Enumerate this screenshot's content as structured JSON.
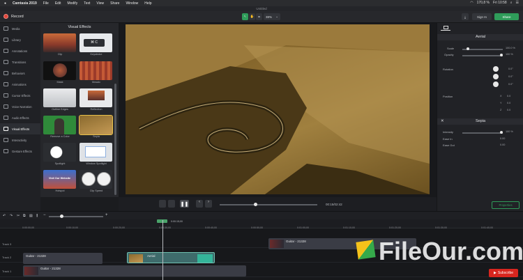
{
  "menubar": {
    "apple": "",
    "items": [
      "Camtasia 2019",
      "File",
      "Edit",
      "Modify",
      "Text",
      "View",
      "Share",
      "Window",
      "Help"
    ],
    "status": {
      "battery": "170,8 %",
      "clock": "Fri 10:58"
    }
  },
  "window": {
    "title": "Untitled"
  },
  "toolbar": {
    "record_label": "Record",
    "zoom": "38%",
    "signin_label": "Sign In",
    "share_label": "Share"
  },
  "rail": {
    "items": [
      "Media",
      "Library",
      "Annotations",
      "Transitions",
      "Behaviors",
      "Animations",
      "Cursor Effects",
      "Voice Narration",
      "Audio Effects",
      "Visual Effects",
      "Interactivity",
      "Gesture Effects"
    ]
  },
  "fx": {
    "title": "Visual Effects",
    "items": [
      {
        "label": "Clip"
      },
      {
        "label": "Keystroke"
      },
      {
        "label": "Mask"
      },
      {
        "label": "Mosaic"
      },
      {
        "label": "Outline Edges"
      },
      {
        "label": "Reflection"
      },
      {
        "label": "Remove a Color"
      },
      {
        "label": "Sepia"
      },
      {
        "label": "Spotlight"
      },
      {
        "label": "Window Spotlight"
      },
      {
        "label": "Hotspot"
      },
      {
        "label": "Clip Speed"
      }
    ],
    "keystroke_text": "⌘ C",
    "hotspot_text": "Visit Our Website"
  },
  "props": {
    "section1": "Aerial",
    "scale_label": "Scale",
    "scale_value": "100.0 %",
    "opacity_label": "Opacity",
    "opacity_value": "100 %",
    "rotation_label": "Rotation",
    "rotation_values": [
      "0.0°",
      "0.0°",
      "0.0°"
    ],
    "position_label": "Position",
    "position_values": [
      "0.0",
      "0.0",
      "0.0"
    ],
    "position_axes": [
      "X",
      "Y",
      "Z"
    ],
    "section2": "Sepia",
    "intensity_label": "Intensity",
    "intensity_value": "100 %",
    "easein_label": "Ease In",
    "easein_value": "0.00",
    "easeout_label": "Ease Out",
    "easeout_value": "0.00"
  },
  "transport": {
    "time": "00:15/02:42",
    "properties_label": "Properties"
  },
  "timeline": {
    "playhead_time": "0:00:15;00",
    "ruler": [
      "0:00:00;00",
      "0:00:10;00",
      "0:00:20;00",
      "0:00:30;00",
      "0:00:40;00",
      "0:00:50;00",
      "0:01:00;00",
      "0:01:10;00",
      "0:01:20;00",
      "0:01:30;00",
      "0:01:40;00",
      "0:01:50;00",
      "0:02:00;00"
    ],
    "tracks": [
      {
        "name": "Track 3"
      },
      {
        "name": "Track 2"
      },
      {
        "name": "Track 1"
      }
    ],
    "clips": {
      "guitar_t3": "Guitar - 21328",
      "guitar_t2": "Guitar - 21328",
      "aerial_t2": "Aerial",
      "guitar_t1": "Guitar - 21328"
    }
  },
  "watermark": {
    "text": "FileOur.com"
  },
  "youtube": {
    "label": "Subscribe"
  },
  "colors": {
    "accent": "#2f9c5a",
    "record": "#e0453a",
    "selected": "#e8c14a",
    "sepia": "#8a6a2e",
    "clip_audio": "#3a3c45",
    "clip_selected": "#3e6b6b"
  }
}
